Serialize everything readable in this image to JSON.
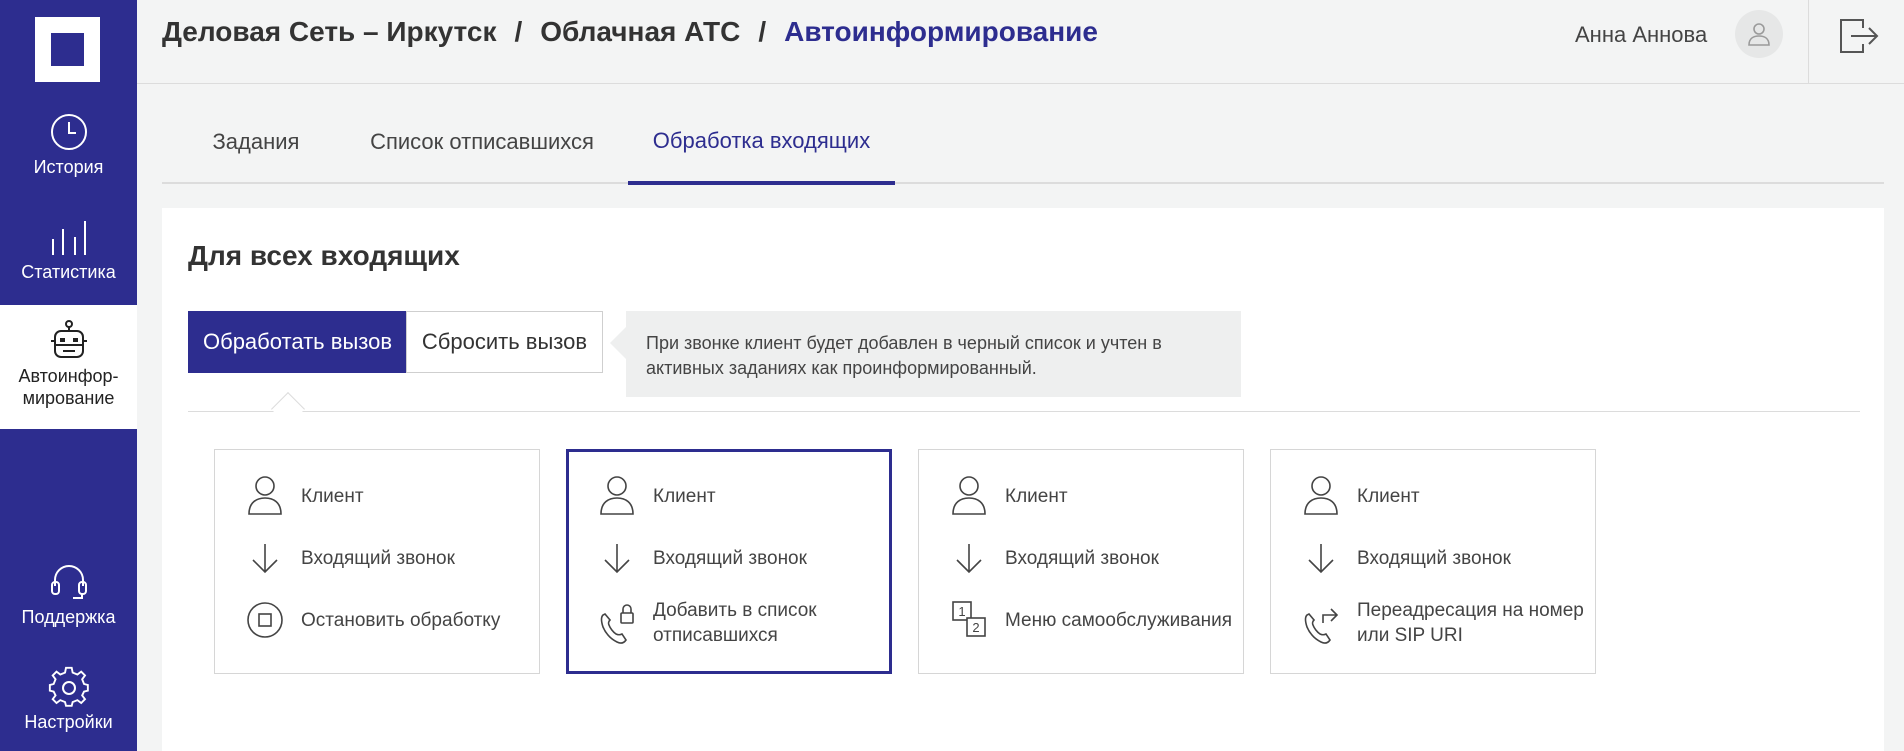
{
  "sidebar": {
    "items": [
      {
        "label": "История",
        "icon": "clock-icon"
      },
      {
        "label": "Статистика",
        "icon": "bar-chart-icon"
      },
      {
        "label": "Автоинфор-\nмирование",
        "icon": "robot-icon",
        "active": true
      },
      {
        "label": "Поддержка",
        "icon": "headset-icon"
      },
      {
        "label": "Настройки",
        "icon": "gear-icon"
      }
    ]
  },
  "header": {
    "breadcrumb": [
      "Деловая Сеть – Иркутск",
      "Облачная АТС",
      "Автоинформирование"
    ],
    "separator": "/",
    "user_name": "Анна Аннова"
  },
  "tabs": [
    {
      "label": "Задания"
    },
    {
      "label": "Список отписавшихся"
    },
    {
      "label": "Обработка входящих",
      "active": true
    }
  ],
  "panel": {
    "title": "Для всех входящих",
    "segments": [
      {
        "label": "Обработать вызов",
        "active": true
      },
      {
        "label": "Сбросить вызов"
      }
    ],
    "note": "При звонке клиент будет добавлен в черный список и учтен в активных заданиях как проинформированный.",
    "cards": [
      {
        "rows": [
          {
            "icon": "person-icon",
            "text": "Клиент"
          },
          {
            "icon": "arrow-down-icon",
            "text": "Входящий звонок"
          },
          {
            "icon": "stop-icon",
            "text": "Остановить обработку"
          }
        ]
      },
      {
        "selected": true,
        "rows": [
          {
            "icon": "person-icon",
            "text": "Клиент"
          },
          {
            "icon": "arrow-down-icon",
            "text": "Входящий звонок"
          },
          {
            "icon": "phone-lock-icon",
            "text": "Добавить в список отписавшихся"
          }
        ]
      },
      {
        "rows": [
          {
            "icon": "person-icon",
            "text": "Клиент"
          },
          {
            "icon": "arrow-down-icon",
            "text": "Входящий звонок"
          },
          {
            "icon": "menu-12-icon",
            "text": "Меню самообслуживания"
          }
        ]
      },
      {
        "rows": [
          {
            "icon": "person-icon",
            "text": "Клиент"
          },
          {
            "icon": "arrow-down-icon",
            "text": "Входящий звонок"
          },
          {
            "icon": "phone-forward-icon",
            "text": "Переадресация на номер или SIP URI"
          }
        ]
      }
    ]
  },
  "colors": {
    "brand": "#2d2d8f",
    "background": "#f3f4f4",
    "panel": "#ffffff"
  }
}
